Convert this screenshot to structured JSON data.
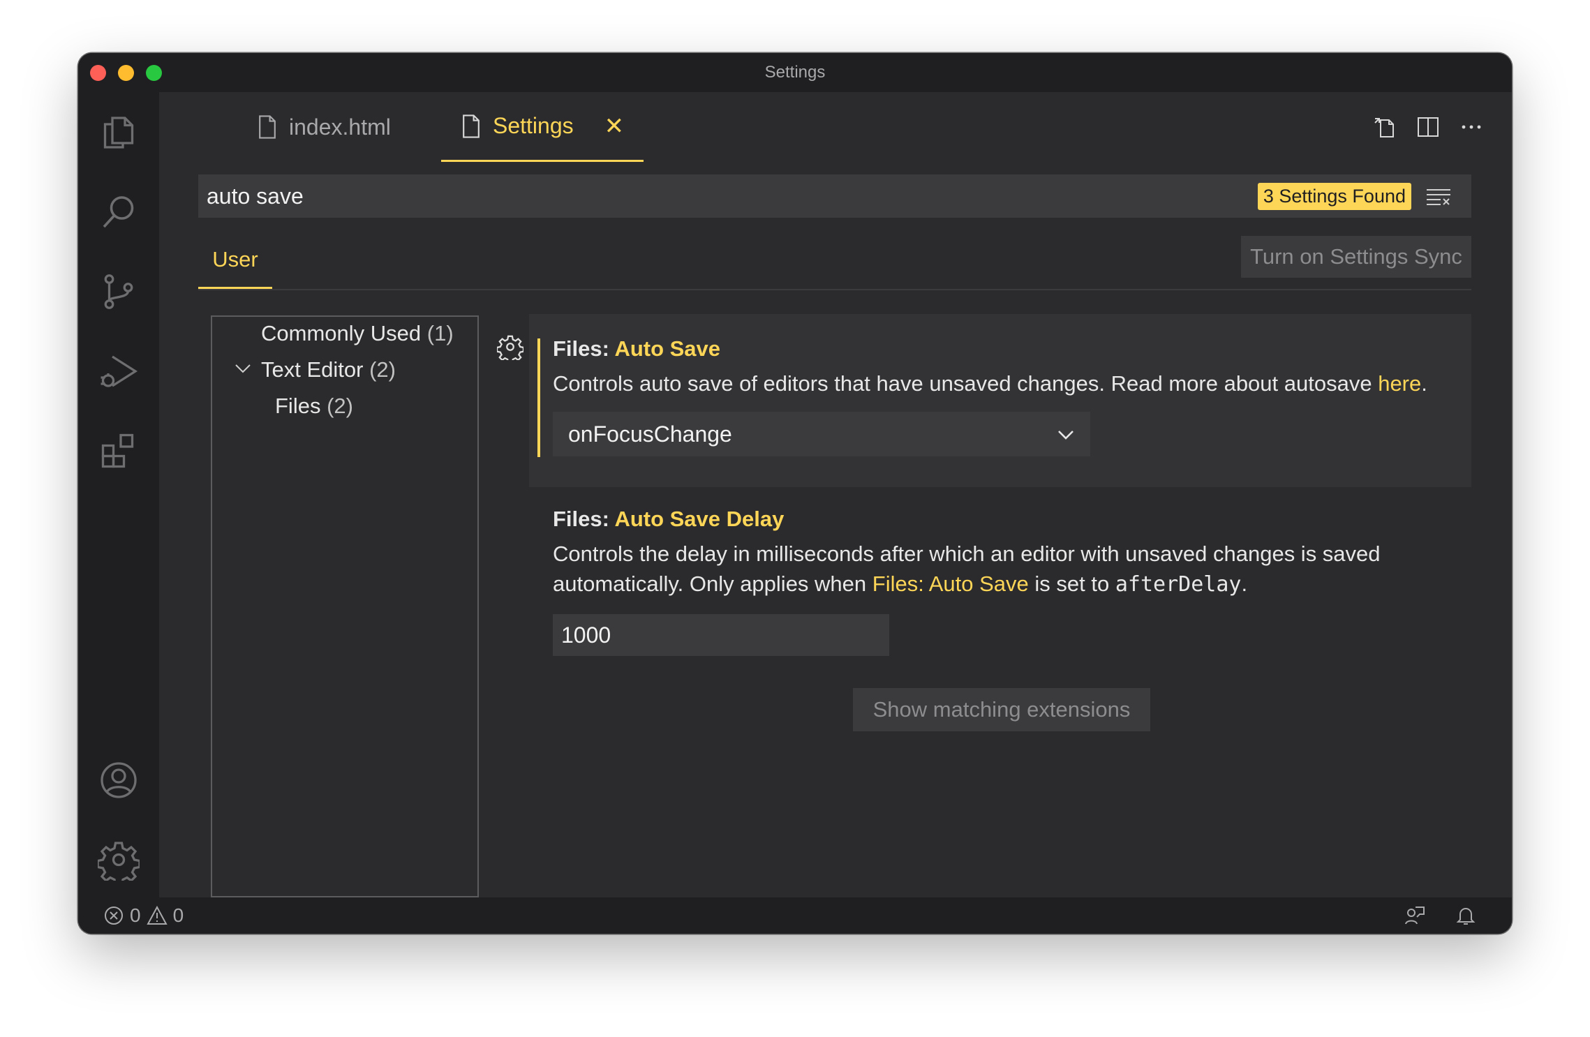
{
  "window": {
    "title": "Settings"
  },
  "activity_bar": {
    "icons": [
      "explorer-icon",
      "search-icon",
      "source-control-icon",
      "run-debug-icon",
      "extensions-icon",
      "account-icon",
      "manage-gear-icon"
    ]
  },
  "tabs": [
    {
      "label": "index.html",
      "active": false
    },
    {
      "label": "Settings",
      "active": true,
      "close_glyph": "✕"
    }
  ],
  "search": {
    "value": "auto save",
    "results_badge": "3 Settings Found"
  },
  "scope": {
    "tab_label": "User",
    "sync_button": "Turn on Settings Sync"
  },
  "toc": {
    "items": [
      {
        "label": "Commonly Used",
        "count": "(1)"
      },
      {
        "label": "Text Editor",
        "count": "(2)",
        "expanded": true
      },
      {
        "label": "Files",
        "count": "(2)"
      }
    ]
  },
  "settings": [
    {
      "category": "Files: ",
      "name": "Auto Save",
      "description": "Controls auto save of editors that have unsaved changes. Read more about autosave ",
      "link_text": "here",
      "description_end": ".",
      "value": "onFocusChange"
    },
    {
      "category": "Files: ",
      "name": "Auto Save Delay",
      "description_line1": "Controls the delay in milliseconds after which an editor with unsaved changes is saved",
      "description_line2_start": "automatically. Only applies when ",
      "description_link": "Files: Auto Save",
      "description_mid": " is set to ",
      "description_code": "afterDelay",
      "description_end": ".",
      "value": "1000"
    }
  ],
  "extensions_button": "Show matching extensions",
  "status": {
    "errors": "0",
    "warnings": "0"
  },
  "colors": {
    "accent": "#fdd658",
    "background": "#2b2a2c",
    "sidebar": "#1f1e20",
    "input": "#3b3a3d"
  }
}
